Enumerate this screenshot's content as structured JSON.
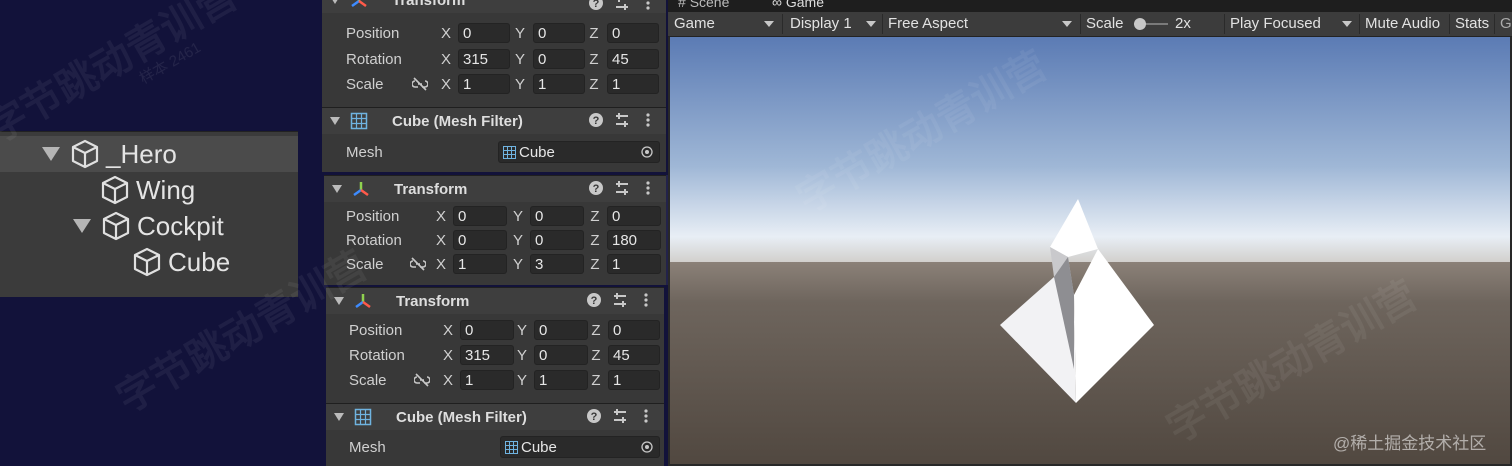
{
  "hierarchy": {
    "items": [
      {
        "label": "_Hero",
        "expanded": true
      },
      {
        "label": "Wing"
      },
      {
        "label": "Cockpit",
        "expanded": true
      },
      {
        "label": "Cube"
      }
    ]
  },
  "panel1": {
    "header": "Transform",
    "rows": [
      {
        "label": "Position",
        "x": "0",
        "y": "0",
        "z": "0"
      },
      {
        "label": "Rotation",
        "x": "315",
        "y": "0",
        "z": "45"
      },
      {
        "label": "Scale",
        "x": "1",
        "y": "1",
        "z": "1"
      }
    ],
    "mesh_filter": {
      "header": "Cube (Mesh Filter)",
      "label": "Mesh",
      "value": "Cube"
    }
  },
  "panel2": {
    "header": "Transform",
    "rows": [
      {
        "label": "Position",
        "x": "0",
        "y": "0",
        "z": "0"
      },
      {
        "label": "Rotation",
        "x": "0",
        "y": "0",
        "z": "180"
      },
      {
        "label": "Scale",
        "x": "1",
        "y": "3",
        "z": "1"
      }
    ]
  },
  "panel3": {
    "header": "Transform",
    "rows": [
      {
        "label": "Position",
        "x": "0",
        "y": "0",
        "z": "0"
      },
      {
        "label": "Rotation",
        "x": "315",
        "y": "0",
        "z": "45"
      },
      {
        "label": "Scale",
        "x": "1",
        "y": "1",
        "z": "1"
      }
    ],
    "mesh_filter": {
      "header": "Cube (Mesh Filter)",
      "label": "Mesh",
      "value": "Cube"
    }
  },
  "axes": {
    "x": "X",
    "y": "Y",
    "z": "Z"
  },
  "game_view": {
    "tabs": {
      "scene": "Scene",
      "game": "Game"
    },
    "toolbar": {
      "mode": "Game",
      "display": "Display 1",
      "aspect": "Free Aspect",
      "scale_label": "Scale",
      "scale_value": "2x",
      "play_mode": "Play Focused",
      "mute": "Mute Audio",
      "stats": "Stats"
    }
  },
  "watermark": {
    "text": "字节跳动青训营",
    "id": "样本 2461",
    "credit": "@稀土掘金技术社区"
  },
  "colors": {
    "accent_selected": "#4b4b4b",
    "panel": "#383838",
    "field": "#2a2a2a"
  }
}
